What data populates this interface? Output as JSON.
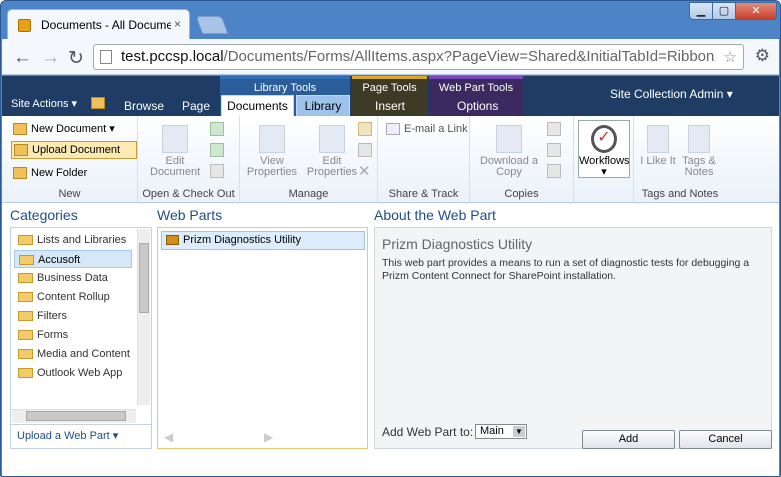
{
  "browser": {
    "tab_title": "Documents - All Documen",
    "tab_close": "×",
    "url_host": "test.pccsp.local",
    "url_path": "/Documents/Forms/AllItems.aspx?PageView=Shared&InitialTabId=Ribbon.WebPa",
    "back": "←",
    "forward": "→",
    "reload": "↻",
    "star": "☆",
    "wrench": "⚙",
    "min": "▁",
    "max": "▢",
    "close": "✕"
  },
  "sp": {
    "site_actions": "Site Actions ▾",
    "tabs": {
      "browse": "Browse",
      "page": "Page",
      "documents": "Documents",
      "library": "Library",
      "insert": "Insert",
      "options": "Options"
    },
    "ctx": {
      "library_tools": "Library Tools",
      "page_tools": "Page Tools",
      "webpart_tools": "Web Part Tools"
    },
    "user": "Site Collection Admin ▾",
    "colors": {
      "library_tools": "#2f6fb8",
      "page_tools": "#d6a92b",
      "webpart_tools": "#7a46b8"
    }
  },
  "ribbon": {
    "new_document": "New Document ▾",
    "upload_document": "Upload Document",
    "new_folder": "New Folder",
    "g_new": "New",
    "edit_document": "Edit Document",
    "g_open": "Open & Check Out",
    "view_properties": "View Properties",
    "edit_properties": "Edit Properties",
    "g_manage": "Manage",
    "email_link": "E-mail a Link",
    "g_share": "Share & Track",
    "download_copy": "Download a Copy",
    "g_copies": "Copies",
    "workflows": "Workflows",
    "g_workflows": "",
    "i_like_it": "I Like It",
    "tags_notes": "Tags & Notes",
    "g_tags": "Tags and Notes"
  },
  "main": {
    "categories_title": "Categories",
    "webparts_title": "Web Parts",
    "about_title": "About the Web Part",
    "categories": [
      "Lists and Libraries",
      "Accusoft",
      "Business Data",
      "Content Rollup",
      "Filters",
      "Forms",
      "Media and Content",
      "Outlook Web App"
    ],
    "selected_category": "Accusoft",
    "upload_webpart": "Upload a Web Part ▾",
    "webpart_item": "Prizm Diagnostics Utility",
    "about_name": "Prizm Diagnostics Utility",
    "about_desc": "This web part provides a means to run a set of diagnostic tests for debugging a Prizm Content Connect for SharePoint installation.",
    "add_to_label": "Add Web Part to:",
    "add_to_value": "Main",
    "add_button": "Add",
    "cancel_button": "Cancel"
  }
}
